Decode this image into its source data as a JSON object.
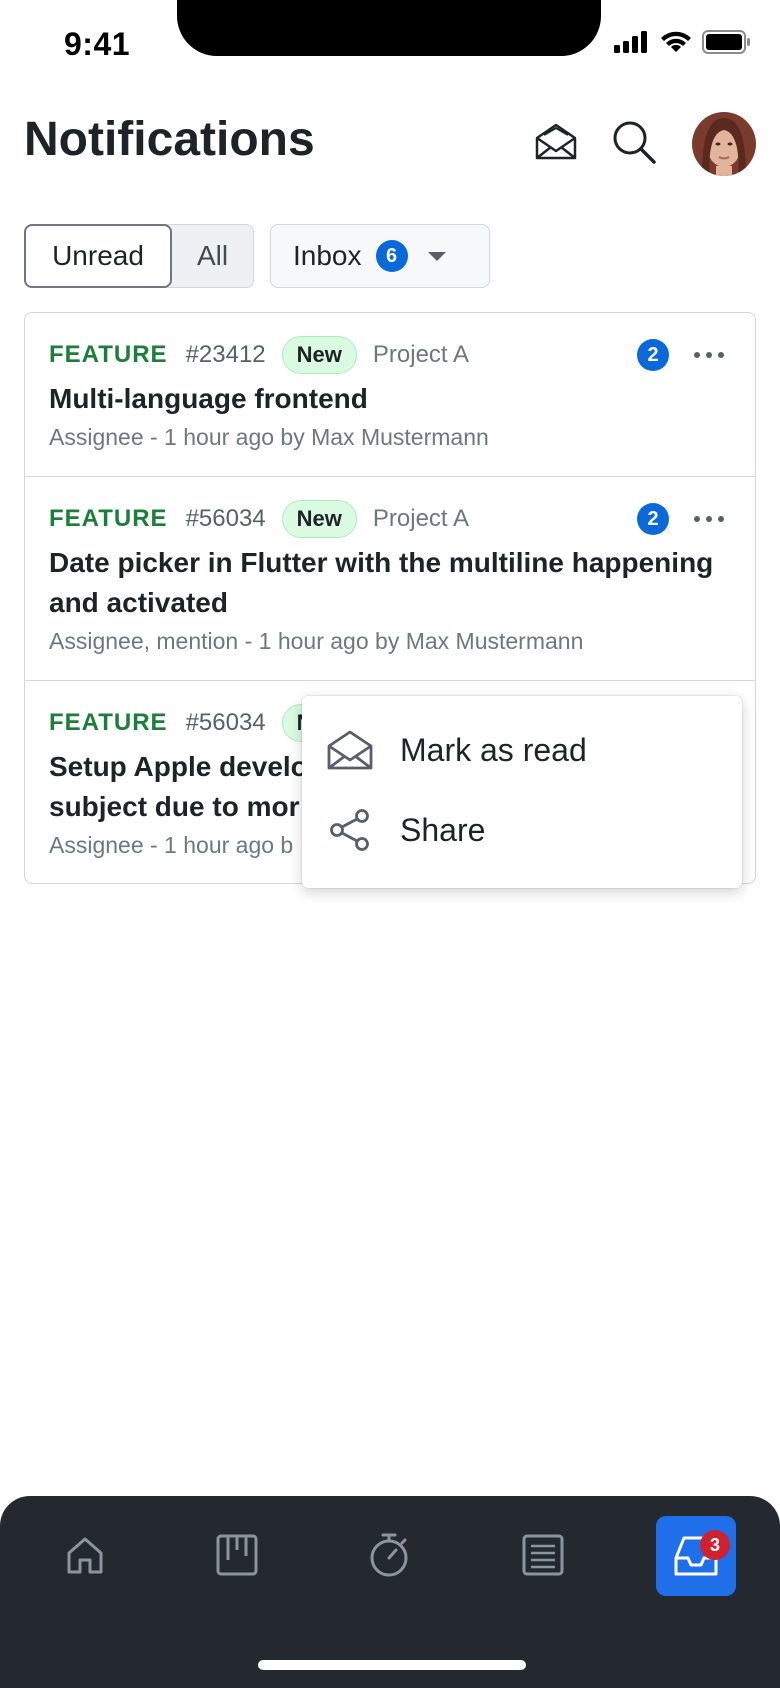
{
  "status_bar": {
    "time": "9:41"
  },
  "header": {
    "title": "Notifications",
    "icons": {
      "mark_read": "envelope-open-icon",
      "search": "search-icon"
    }
  },
  "filters": {
    "unread_label": "Unread",
    "all_label": "All",
    "inbox_label": "Inbox",
    "inbox_count": "6"
  },
  "notifications": [
    {
      "type": "FEATURE",
      "number": "#23412",
      "status": "New",
      "project": "Project A",
      "title": "Multi-language frontend",
      "subtitle": "Assignee - 1 hour ago by Max Mustermann",
      "count": "2"
    },
    {
      "type": "FEATURE",
      "number": "#56034",
      "status": "New",
      "project": "Project A",
      "title": "Date picker in Flutter with the multiline happening and activated",
      "subtitle": "Assignee, mention - 1 hour ago by Max Mustermann",
      "count": "2"
    },
    {
      "type": "FEATURE",
      "number": "#56034",
      "status": "N",
      "title_line1": "Setup Apple develo",
      "title_line2": "subject due to mor",
      "subtitle": "Assignee - 1 hour ago b"
    }
  ],
  "context_menu": {
    "items": [
      {
        "label": "Mark as read",
        "icon": "envelope-open-icon"
      },
      {
        "label": "Share",
        "icon": "share-icon"
      }
    ]
  },
  "bottom_nav": {
    "items": [
      {
        "name": "home",
        "icon": "home-icon"
      },
      {
        "name": "board",
        "icon": "board-icon"
      },
      {
        "name": "timer",
        "icon": "stopwatch-icon"
      },
      {
        "name": "list",
        "icon": "list-icon"
      },
      {
        "name": "inbox",
        "icon": "inbox-icon",
        "badge": "3",
        "active": true
      }
    ]
  },
  "colors": {
    "accent": "#0969da",
    "feature_green": "#1a7f37",
    "nav_background": "#24292f",
    "nav_active": "#1f6feb",
    "badge_red": "#cf222e"
  }
}
